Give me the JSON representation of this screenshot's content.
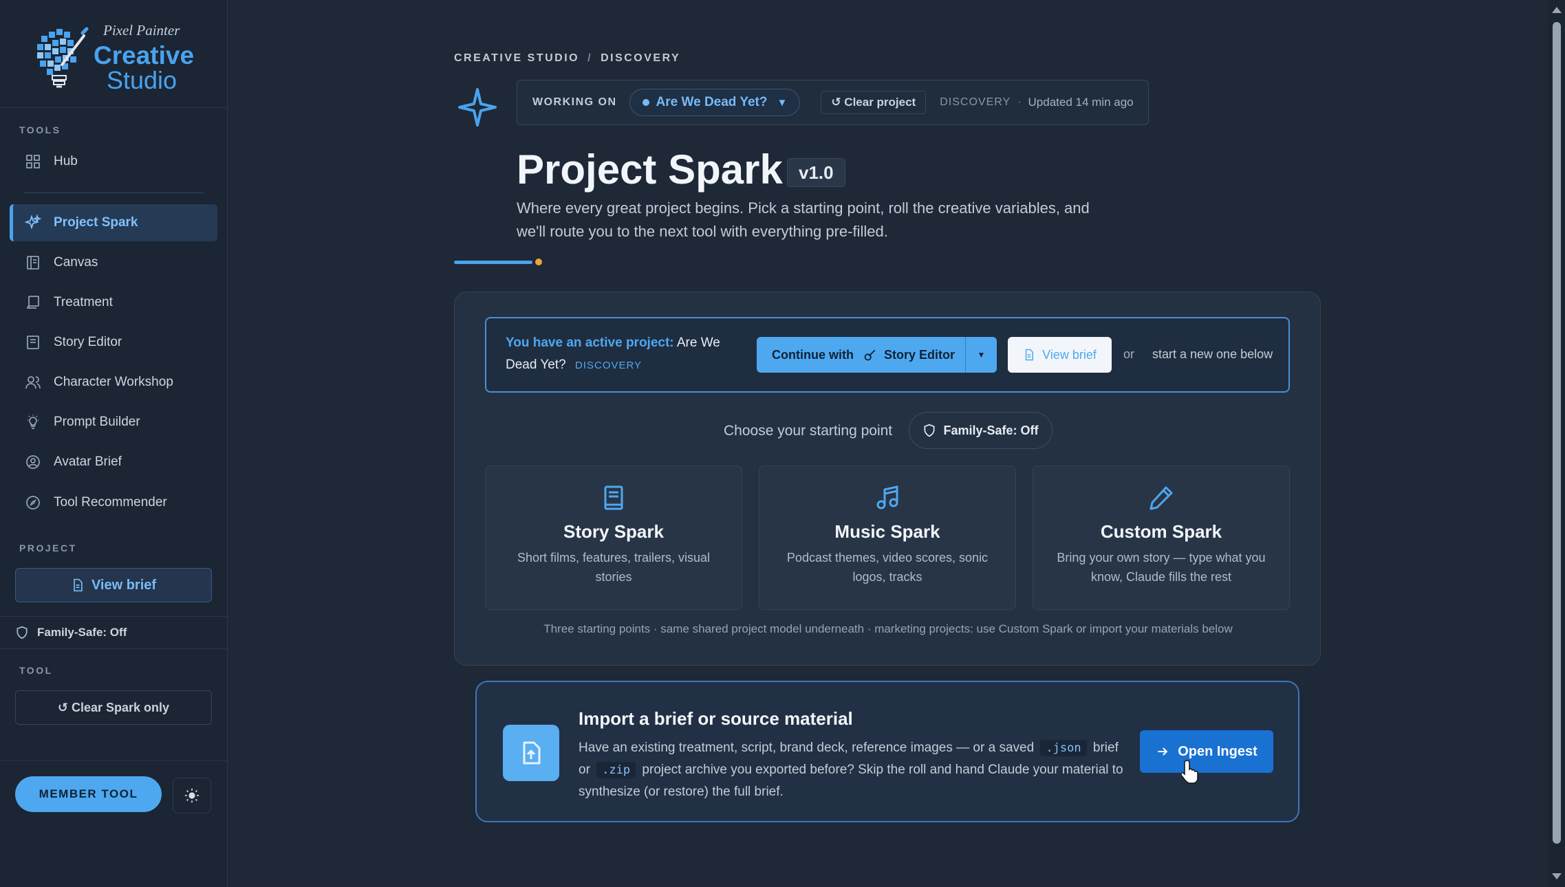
{
  "brand": {
    "small": "Pixel Painter",
    "line1": "Creative",
    "line2": "Studio"
  },
  "sidebar": {
    "tools_label": "TOOLS",
    "hub": "Hub",
    "items": [
      {
        "label": "Project Spark",
        "icon": "sparkles-icon",
        "active": true
      },
      {
        "label": "Canvas",
        "icon": "canvas-icon"
      },
      {
        "label": "Treatment",
        "icon": "treatment-icon"
      },
      {
        "label": "Story Editor",
        "icon": "story-editor-icon"
      },
      {
        "label": "Character Workshop",
        "icon": "users-icon"
      },
      {
        "label": "Prompt Builder",
        "icon": "lightbulb-icon"
      },
      {
        "label": "Avatar Brief",
        "icon": "avatar-icon"
      },
      {
        "label": "Tool Recommender",
        "icon": "compass-icon"
      }
    ],
    "project_label": "PROJECT",
    "view_brief": "View brief",
    "family_safe": "Family-Safe: Off",
    "tool_label": "TOOL",
    "clear_spark": "↺ Clear Spark only",
    "member_tool": "MEMBER TOOL"
  },
  "breadcrumb": {
    "root": "CREATIVE STUDIO",
    "sep": "/",
    "current": "DISCOVERY"
  },
  "working": {
    "label": "WORKING ON",
    "project": "Are We Dead Yet?",
    "caret": "▼",
    "clear": "↺ Clear project",
    "stage": "DISCOVERY",
    "dot": "·",
    "updated": "Updated 14 min ago"
  },
  "page": {
    "title": "Project Spark",
    "version": "v1.0",
    "subtitle": "Where every great project begins. Pick a starting point, roll the creative variables, and we'll route you to the next tool with everything pre-filled."
  },
  "active_banner": {
    "lead": "You have an active project:",
    "project": "Are We Dead Yet?",
    "stage": "DISCOVERY",
    "continue_prefix": "Continue with",
    "continue_tool": "Story Editor",
    "view_brief": "View brief",
    "or": "or",
    "new_one": "start a new one below"
  },
  "starting": {
    "label": "Choose your starting point",
    "family_safe": "Family-Safe: Off",
    "cards": [
      {
        "title": "Story Spark",
        "desc": "Short films, features, trailers, visual stories",
        "icon": "book-icon"
      },
      {
        "title": "Music Spark",
        "desc": "Podcast themes, video scores, sonic logos, tracks",
        "icon": "music-icon"
      },
      {
        "title": "Custom Spark",
        "desc": "Bring your own story — type what you know, Claude fills the rest",
        "icon": "pencil-icon"
      }
    ],
    "footnote": "Three starting points · same shared project model underneath · marketing projects: use Custom Spark or import your materials below"
  },
  "import": {
    "title": "Import a brief or source material",
    "desc_1": "Have an existing treatment, script, brand deck, reference images — or a saved",
    "code_json": ".json",
    "desc_2": "brief or",
    "code_zip": ".zip",
    "desc_3": "project archive you exported before? Skip the roll and hand Claude your material to synthesize (or restore) the full brief.",
    "button": "Open Ingest"
  },
  "colors": {
    "accent": "#4ea8f0",
    "bg": "#1e2836",
    "sidebar": "#1b2533",
    "primary_button": "#1971d2",
    "progress_dot": "#f0a23a"
  }
}
